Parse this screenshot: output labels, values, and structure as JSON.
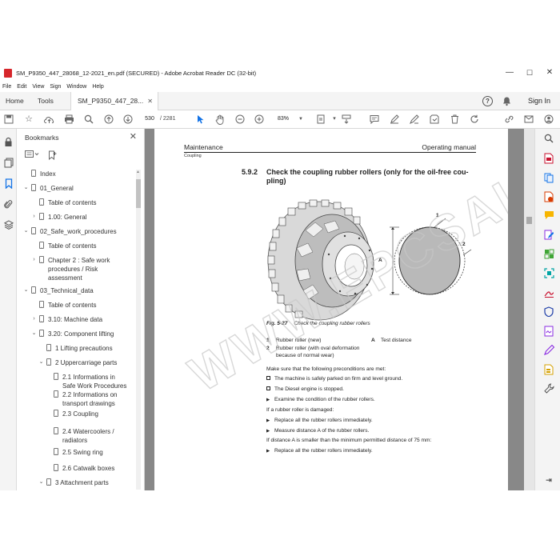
{
  "window": {
    "title": "SM_P9350_447_28068_12-2021_en.pdf (SECURED) - Adobe Acrobat Reader DC (32-bit)",
    "controls": [
      "—",
      "☐",
      "✕"
    ]
  },
  "menubar": [
    "File",
    "Edit",
    "View",
    "Sign",
    "Window",
    "Help"
  ],
  "tabs": {
    "home": "Home",
    "tools": "Tools",
    "document": "SM_P9350_447_28...",
    "close": "✕",
    "help": "?",
    "signin": "Sign In"
  },
  "toolbar": {
    "page_current": "530",
    "page_total": "/ 2281",
    "zoom": "83%"
  },
  "bookmarks": {
    "title": "Bookmarks",
    "close": "✕",
    "items": [
      {
        "label": "Index",
        "level": 0,
        "chevron": ""
      },
      {
        "label": "01_General",
        "level": 0,
        "chevron": "⌄"
      },
      {
        "label": "Table of contents",
        "level": 1,
        "chevron": ""
      },
      {
        "label": "1.00: General",
        "level": 1,
        "chevron": "›"
      },
      {
        "label": "02_Safe_work_procedures",
        "level": 0,
        "chevron": "⌄"
      },
      {
        "label": "Table of contents",
        "level": 1,
        "chevron": ""
      },
      {
        "label": "Chapter 2 : Safe work procedures / Risk assessment",
        "level": 1,
        "chevron": "›"
      },
      {
        "label": "03_Technical_data",
        "level": 0,
        "chevron": "⌄"
      },
      {
        "label": "Table of contents",
        "level": 1,
        "chevron": ""
      },
      {
        "label": "3.10: Machine data",
        "level": 1,
        "chevron": "›"
      },
      {
        "label": "3.20: Component lifting",
        "level": 1,
        "chevron": "⌄"
      },
      {
        "label": "1 Lifting precautions",
        "level": 2,
        "chevron": ""
      },
      {
        "label": "2 Uppercarriage parts",
        "level": 2,
        "chevron": "⌄"
      },
      {
        "label": "2.1 Informations in Safe Work Procedures",
        "level": 3,
        "chevron": ""
      },
      {
        "label": "2.2 Informations on transport drawings",
        "level": 3,
        "chevron": ""
      },
      {
        "label": "2.3 Coupling",
        "level": 3,
        "chevron": ""
      },
      {
        "label": "2.4 Watercoolers / radiators",
        "level": 3,
        "chevron": ""
      },
      {
        "label": "2.5 Swing ring",
        "level": 3,
        "chevron": ""
      },
      {
        "label": "2.6 Catwalk boxes",
        "level": 3,
        "chevron": ""
      },
      {
        "label": "3 Attachment parts",
        "level": 2,
        "chevron": "⌄"
      }
    ]
  },
  "page": {
    "header_left": "Maintenance",
    "header_right": "Operating manual",
    "header_sub": "Coupling",
    "section_number": "5.9.2",
    "section_title": "Check the coupling rubber rollers (only for the oil-free cou-pling)",
    "figure": {
      "label_1": "1",
      "label_2": "2",
      "label_A": "A",
      "caption_number": "Fig. 5-27",
      "caption_text": "Check the coupling rubber rollers"
    },
    "legend": [
      {
        "num": "1",
        "text": "Rubber roller (new)",
        "num2": "A",
        "text2": "Test distance"
      },
      {
        "num": "2",
        "text": "Rubber roller (with oval deformation because of normal wear)",
        "num2": "",
        "text2": ""
      }
    ],
    "lines": [
      {
        "mark": "",
        "text": "Make sure that the following preconditions are met:"
      },
      {
        "mark": "box",
        "text": "The machine is safely parked on firm and level ground."
      },
      {
        "mark": "box",
        "text": "The Diesel engine is stopped."
      },
      {
        "mark": "arrow",
        "text": "Examine the condition of the rubber rollers."
      },
      {
        "mark": "",
        "text": "If a rubber roller is damaged:"
      },
      {
        "mark": "arrow",
        "text": "Replace all the rubber rollers immediately."
      },
      {
        "mark": "arrow",
        "text": "Measure distance A of the rubber rollers."
      },
      {
        "mark": "",
        "text": "If distance A is smaller than the minimum permitted distance of 75 mm:"
      },
      {
        "mark": "arrow",
        "text": "Replace all the rubber rollers immediately."
      }
    ],
    "watermark": "WWW.EPCSALE.COM"
  },
  "colors": {
    "accent_blue": "#1473e6",
    "acrobat_red": "#d6262b"
  }
}
